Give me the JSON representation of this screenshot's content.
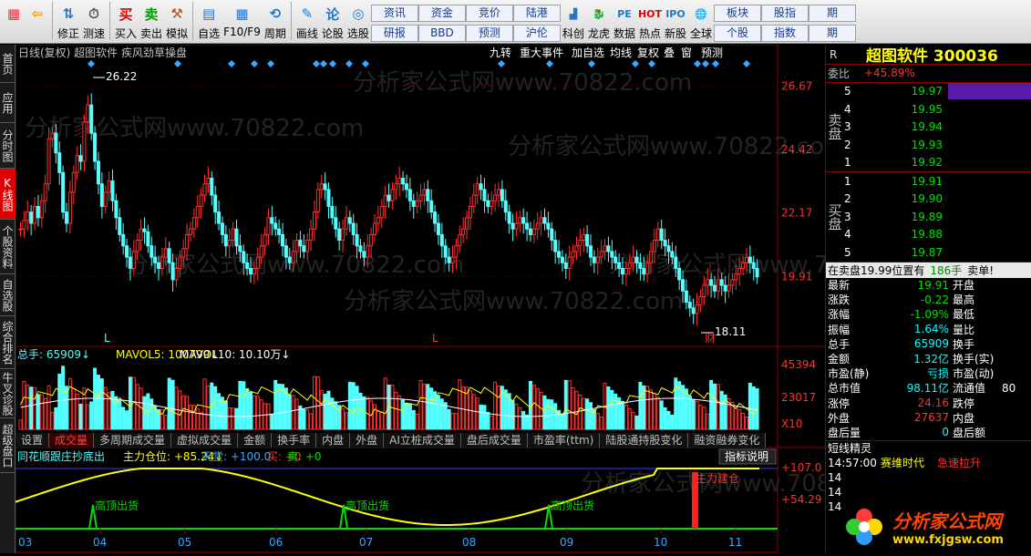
{
  "toolbar": {
    "items": [
      {
        "label": "",
        "icon": "grid-icon"
      },
      {
        "label": "",
        "icon": "back-arrow-icon"
      },
      {
        "label": "修正",
        "icon": "up-down-icon"
      },
      {
        "label": "测速",
        "icon": "clock-icon"
      },
      {
        "label": "买入",
        "icon": "buy-icon"
      },
      {
        "label": "卖出",
        "icon": "sell-icon"
      },
      {
        "label": "模拟",
        "icon": "hammer-icon"
      },
      {
        "label": "自选",
        "icon": "folder-icon"
      },
      {
        "label": "F10/F9",
        "icon": "f10-icon"
      },
      {
        "label": "周期",
        "icon": "period-icon"
      },
      {
        "label": "画线",
        "icon": "pen-icon"
      },
      {
        "label": "论股",
        "icon": "discuss-icon"
      },
      {
        "label": "选股",
        "icon": "select-icon"
      }
    ],
    "small_buttons": [
      [
        "资讯",
        "研报"
      ],
      [
        "资金",
        "BBD"
      ],
      [
        "竞价",
        "预测"
      ],
      [
        "陆港",
        "沪伦"
      ]
    ],
    "items2": [
      {
        "label": "科创",
        "icon": "chart-icon"
      },
      {
        "label": "龙虎",
        "icon": "dragon-icon"
      },
      {
        "label": "数据",
        "icon": "pe-icon"
      },
      {
        "label": "热点",
        "icon": "hot-icon"
      },
      {
        "label": "新股",
        "icon": "ipo-icon"
      },
      {
        "label": "全球",
        "icon": "globe-icon"
      }
    ],
    "small_buttons2": [
      [
        "板块",
        "个股"
      ],
      [
        "股指",
        "指数"
      ],
      [
        "期",
        "期"
      ]
    ]
  },
  "sidebar": [
    "首页",
    "应用",
    "分时图",
    "K线图",
    "个股资料",
    "自选股",
    "综合排名",
    "牛叉诊股",
    "超级盘口"
  ],
  "chart": {
    "header": "日线(复权)  超图软件  疾风劲草操盘",
    "menu": [
      "九转",
      "重大事件",
      "加自选",
      "均线",
      "复权",
      "叠",
      "窗",
      "预测"
    ],
    "max_label": "26.22",
    "min_label": "18.11",
    "right_scale": [
      "26.67",
      "24.42",
      "22.17",
      "19.91"
    ],
    "vol_info": {
      "total": "总手: 65909↓",
      "mavol5": "MAVOL5: 100799↓",
      "mavol10": "MAVOL10: 10.10万↓"
    },
    "vol_scale": [
      "45394",
      "23017",
      "X10"
    ],
    "tabs": [
      "设置",
      "成交量",
      "多周期成交量",
      "虚拟成交量",
      "金额",
      "换手率",
      "内盘",
      "外盘",
      "AI立桩成交量",
      "盘后成交量",
      "市盈率(ttm)",
      "陆股通持股变化",
      "融资融券变化"
    ],
    "indicator_info": {
      "name": "同花顺跟庄抄底出",
      "main": "主力仓位: +85.24↓",
      "sky": "天堂: +100.0",
      "buy": "买: +0",
      "sell": "卖: +0"
    },
    "indicator_btn": "指标说明",
    "ind_scale": [
      "+107.0",
      "+54.29"
    ],
    "ind_labels": [
      "高顶出货",
      "高顶出货",
      "高顶出货",
      "主力建仓"
    ],
    "months": [
      "03",
      "04",
      "05",
      "06",
      "07",
      "08",
      "09",
      "10",
      "11"
    ],
    "markers": [
      "L",
      "L",
      "财"
    ],
    "watermark": "分析家公式网www.70822.com"
  },
  "quote": {
    "r": "R",
    "name": "超图软件 300036",
    "weibi_label": "委比",
    "weibi": "+45.89%",
    "sell_label": "卖盘",
    "sell": [
      [
        "5",
        "19.97"
      ],
      [
        "4",
        "19.95"
      ],
      [
        "3",
        "19.94"
      ],
      [
        "2",
        "19.93"
      ],
      [
        "1",
        "19.92"
      ]
    ],
    "buy_label": "买盘",
    "buy": [
      [
        "1",
        "19.91"
      ],
      [
        "2",
        "19.90"
      ],
      [
        "3",
        "19.89"
      ],
      [
        "4",
        "19.88"
      ],
      [
        "5",
        "19.87"
      ]
    ],
    "trade_line": "在卖盘19.99位置有",
    "trade_qty": "186手",
    "trade_tag": "卖单!",
    "stats": [
      [
        "最新",
        "19.91",
        "开盘",
        ""
      ],
      [
        "涨跌",
        "-0.22",
        "最高",
        ""
      ],
      [
        "涨幅",
        "-1.09%",
        "最低",
        ""
      ],
      [
        "振幅",
        "1.64%",
        "量比",
        ""
      ],
      [
        "总手",
        "65909",
        "换手",
        ""
      ],
      [
        "金额",
        "1.32亿",
        "换手(实)",
        ""
      ],
      [
        "市盈(静)",
        "亏损",
        "市盈(动)",
        ""
      ],
      [
        "总市值",
        "98.11亿",
        "流通值",
        "80"
      ],
      [
        "涨停",
        "24.16",
        "跌停",
        ""
      ],
      [
        "外盘",
        "27637",
        "内盘",
        ""
      ],
      [
        "盘后量",
        "0",
        "盘后额",
        ""
      ]
    ],
    "section": "短线精灵",
    "events": [
      [
        "14:57:00",
        "赛维时代",
        "急速拉升"
      ],
      [
        "14",
        "",
        ""
      ],
      [
        "14",
        "",
        ""
      ],
      [
        "14",
        "",
        ""
      ]
    ],
    "logo_text": "分析家公式网",
    "logo_url": "www.fxjgsw.com"
  }
}
